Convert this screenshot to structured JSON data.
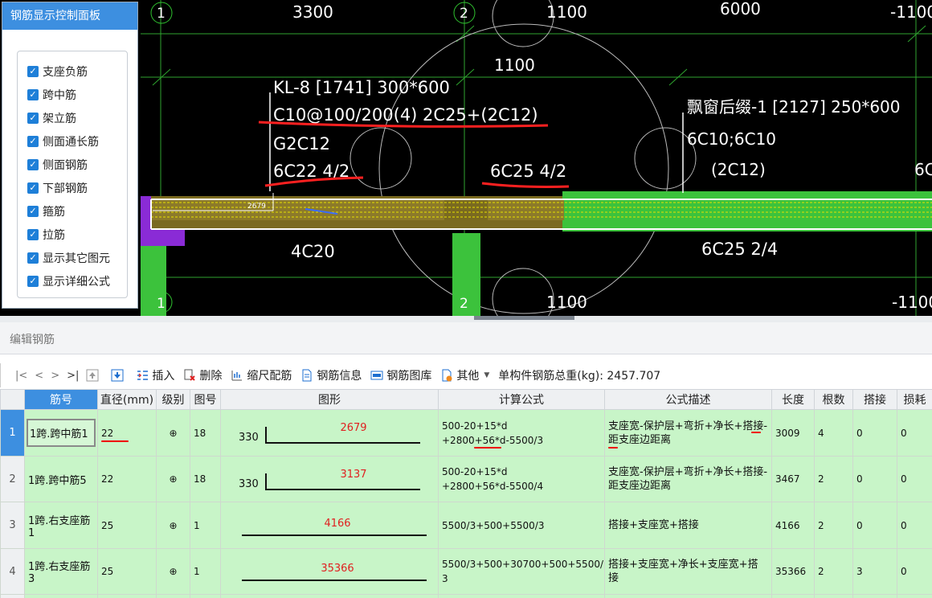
{
  "panel": {
    "title": "钢筋显示控制面板",
    "options": [
      "支座负筋",
      "跨中筋",
      "架立筋",
      "侧面通长筋",
      "侧面钢筋",
      "下部钢筋",
      "箍筋",
      "拉筋",
      "显示其它图元",
      "显示详细公式"
    ]
  },
  "cad": {
    "axis_labels": [
      "1",
      "2",
      "1",
      "2"
    ],
    "dims_top": [
      "3300",
      "1100",
      "6000",
      "-1100"
    ],
    "dim_mid": "1100",
    "dims_bottom": [
      "1100",
      "-1100"
    ],
    "beam_label": [
      "KL-8 [1741] 300*600",
      "C10@100/200(4) 2C25+(2C12)",
      "G2C12",
      "6C22 4/2"
    ],
    "mid_support": "6C25 4/2",
    "right_label": [
      "飘窗后缀-1 [2127] 250*600",
      "6C10;6C10",
      "(2C12)"
    ],
    "right_edge": "6C",
    "bottom_left": "4C20",
    "bottom_right": "6C25 2/4",
    "small_dim": "2679",
    "colors": {
      "green": "#2fc22f",
      "purple": "#8a2bd6",
      "yellow": "#e6e000",
      "red": "#ff2020"
    }
  },
  "edit": {
    "header": "编辑钢筋",
    "nav": [
      "|<",
      "<",
      ">",
      ">|"
    ],
    "buttons": [
      "插入",
      "删除",
      "缩尺配筋",
      "钢筋信息",
      "钢筋图库",
      "其他"
    ],
    "total": "单构件钢筋总重(kg): 2457.707"
  },
  "table": {
    "columns": [
      "筋号",
      "直径(mm)",
      "级别",
      "图号",
      "图形",
      "计算公式",
      "公式描述",
      "长度",
      "根数",
      "搭接",
      "损耗"
    ],
    "level_symbol": "⊕",
    "rows": [
      {
        "no": "1",
        "name": "1跨.跨中筋1",
        "dia": "22",
        "fig_no": "18",
        "fig_side": "330",
        "fig_len": "2679",
        "formula_1": "500-20+15*d",
        "formula_2": "+2800+56*d-5500/3",
        "desc": "支座宽-保护层+弯折+净长+搭接-距支座边距离",
        "length": "3009",
        "count": "4",
        "lap": "0",
        "loss": "0"
      },
      {
        "no": "2",
        "name": "1跨.跨中筋5",
        "dia": "22",
        "fig_no": "18",
        "fig_side": "330",
        "fig_len": "3137",
        "formula_1": "500-20+15*d",
        "formula_2": "+2800+56*d-5500/4",
        "desc": "支座宽-保护层+弯折+净长+搭接-距支座边距离",
        "length": "3467",
        "count": "2",
        "lap": "0",
        "loss": "0"
      },
      {
        "no": "3",
        "name": "1跨.右支座筋1",
        "dia": "25",
        "fig_no": "1",
        "fig_side": "",
        "fig_len": "4166",
        "formula_1": "5500/3+500+5500/3",
        "formula_2": "",
        "desc": "搭接+支座宽+搭接",
        "length": "4166",
        "count": "2",
        "lap": "0",
        "loss": "0"
      },
      {
        "no": "4",
        "name": "1跨.右支座筋3",
        "dia": "25",
        "fig_no": "1",
        "fig_side": "",
        "fig_len": "35366",
        "formula_1": "5500/3+500+30700+500+5500/",
        "formula_2": "3",
        "desc": "搭接+支座宽+净长+支座宽+搭接",
        "length": "35366",
        "count": "2",
        "lap": "3",
        "loss": "0"
      }
    ]
  }
}
